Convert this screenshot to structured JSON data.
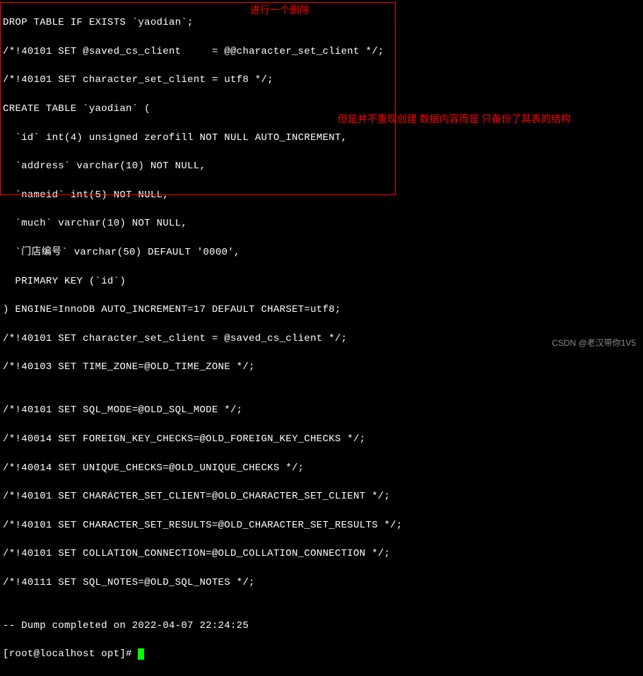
{
  "annotations": {
    "top": "进行一个删除",
    "middle": "但是并不重现创建 数据内容而是 只备份了其表的结构"
  },
  "sql": {
    "l01": "DROP TABLE IF EXISTS `yaodian`;",
    "l02": "/*!40101 SET @saved_cs_client     = @@character_set_client */;",
    "l03": "/*!40101 SET character_set_client = utf8 */;",
    "l04": "CREATE TABLE `yaodian` (",
    "l05": "  `id` int(4) unsigned zerofill NOT NULL AUTO_INCREMENT,",
    "l06": "  `address` varchar(10) NOT NULL,",
    "l07": "  `nameid` int(5) NOT NULL,",
    "l08": "  `much` varchar(10) NOT NULL,",
    "l09": "  `门店编号` varchar(50) DEFAULT '0000',",
    "l10": "  PRIMARY KEY (`id`)",
    "l11": ") ENGINE=InnoDB AUTO_INCREMENT=17 DEFAULT CHARSET=utf8;",
    "l12": "/*!40101 SET character_set_client = @saved_cs_client */;",
    "l13": "/*!40103 SET TIME_ZONE=@OLD_TIME_ZONE */;",
    "l14": "",
    "l15": "/*!40101 SET SQL_MODE=@OLD_SQL_MODE */;",
    "l16": "/*!40014 SET FOREIGN_KEY_CHECKS=@OLD_FOREIGN_KEY_CHECKS */;",
    "l17": "/*!40014 SET UNIQUE_CHECKS=@OLD_UNIQUE_CHECKS */;",
    "l18": "/*!40101 SET CHARACTER_SET_CLIENT=@OLD_CHARACTER_SET_CLIENT */;",
    "l19": "/*!40101 SET CHARACTER_SET_RESULTS=@OLD_CHARACTER_SET_RESULTS */;",
    "l20": "/*!40101 SET COLLATION_CONNECTION=@OLD_COLLATION_CONNECTION */;",
    "l21": "/*!40111 SET SQL_NOTES=@OLD_SQL_NOTES */;",
    "l22": "",
    "l23": "-- Dump completed on 2022-04-07 22:24:25"
  },
  "prompt": "[root@localhost opt]# ",
  "watermark": "CSDN @老汉带你1V5"
}
